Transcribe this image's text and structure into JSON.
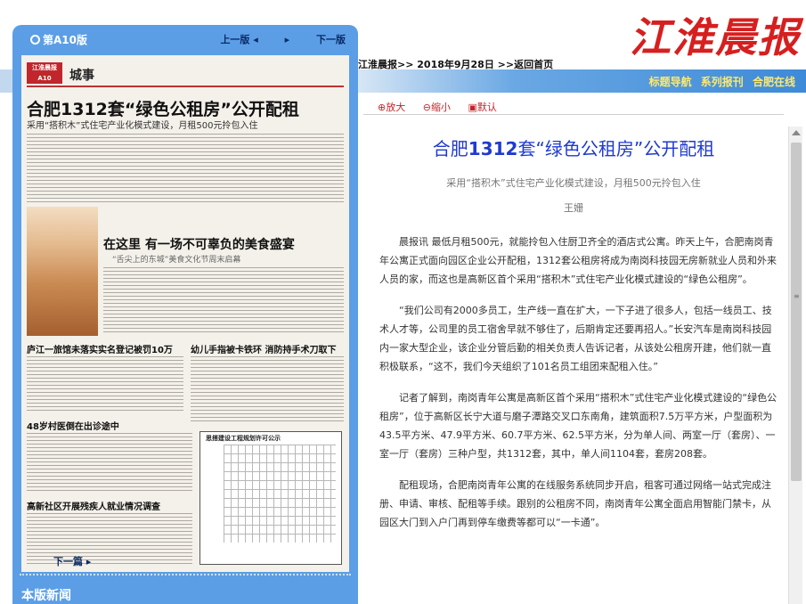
{
  "masthead": {
    "logo": "江淮晨报",
    "breadcrumb": "江淮晨报>> 2018年9月28日  >>返回首页"
  },
  "navbar": {
    "links": [
      "标题导航",
      "系列报刊",
      "合肥在线"
    ]
  },
  "left_panel": {
    "edition": "第A10版",
    "prev": "上一版",
    "next_edition": "下一版",
    "next_page": "下一篇",
    "section_title": "本版新闻"
  },
  "newspaper": {
    "badge": "江淮晨报 A10",
    "section": "城事",
    "headline": "合肥1312套“绿色公租房”公开配租",
    "subheadline": "采用“搭积木”式住宅产业化模式建设，月租500元拎包入住",
    "food_title": "在这里 有一场不可辜负的美食盛宴",
    "food_sub": "“舌尖上的东城”美食文化节周末启幕",
    "h_a": "庐江一旅馆未落实实名登记被罚10万",
    "h_b": "幼儿手指被卡铁环 消防持手术刀取下",
    "h_c": "48岁村医倒在出诊途中",
    "h_d": "高新社区开展残疾人就业情况调查",
    "notice": "思搭建设工程规划许可公示"
  },
  "tools": {
    "zoom_in": "放大",
    "zoom_out": "缩小",
    "default": "默认"
  },
  "article": {
    "title_pre": "合肥",
    "title_num": "1312",
    "title_post": "套“绿色公租房”公开配租",
    "subtitle": "采用“搭积木”式住宅产业化模式建设，月租500元拎包入住",
    "author": "王姗",
    "paragraphs": [
      "晨报讯 最低月租500元，就能拎包入住厨卫齐全的酒店式公寓。昨天上午，合肥南岗青年公寓正式面向园区企业公开配租，1312套公租房将成为南岗科技园无房新就业人员和外来人员的家，而这也是高新区首个采用“搭积木”式住宅产业化模式建设的“绿色公租房”。",
      "“我们公司有2000多员工，生产线一直在扩大，一下子进了很多人，包括一线员工、技术人才等，公司里的员工宿舍早就不够住了，后期肯定还要再招人。”长安汽车是南岗科技园内一家大型企业，该企业分管后勤的相关负责人告诉记者，从该处公租房开建，他们就一直积极联系，“这不，我们今天组织了101名员工组团来配租入住。”",
      "记者了解到，南岗青年公寓是高新区首个采用“搭积木”式住宅产业化模式建设的“绿色公租房”，位于高新区长宁大道与磨子潭路交叉口东南角，建筑面积7.5万平方米，户型面积为43.5平方米、47.9平方米、60.7平方米、62.5平方米，分为单人间、两室一厅（套房）、一室一厅（套房）三种户型，共1312套，其中，单人间1104套，套房208套。",
      "配租现场，合肥南岗青年公寓的在线服务系统同步开启，租客可通过网络一站式完成注册、申请、审核、配租等手续。跟别的公租房不同，南岗青年公寓全面启用智能门禁卡，从园区大门到入户门再到停车缴费等都可以“一卡通”。"
    ]
  }
}
